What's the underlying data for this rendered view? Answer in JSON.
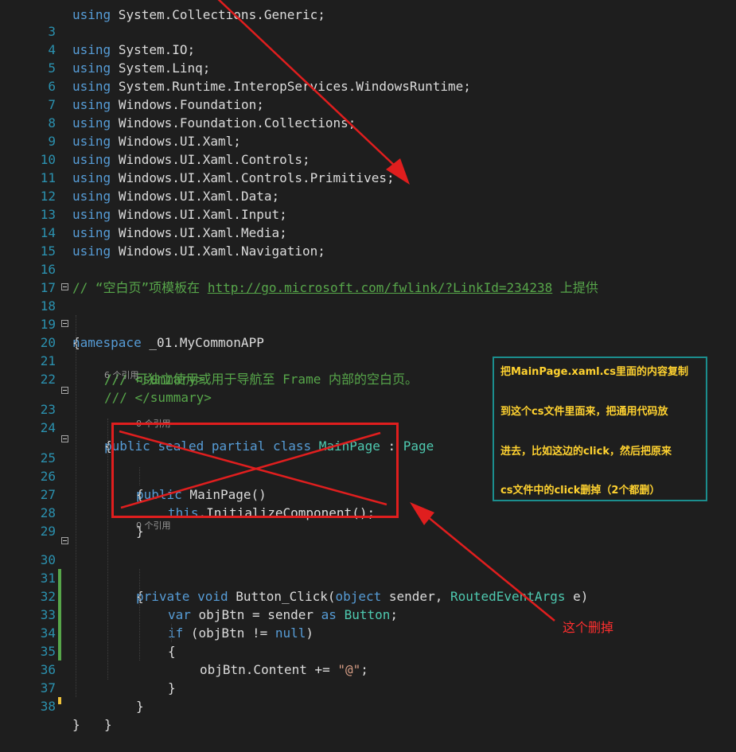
{
  "editor": {
    "line_numbers": [
      "3",
      "4",
      "5",
      "6",
      "7",
      "8",
      "9",
      "10",
      "11",
      "12",
      "13",
      "14",
      "15",
      "16",
      "17",
      "18",
      "19",
      "20",
      "21",
      "22",
      "23",
      "24",
      "25",
      "26",
      "27",
      "28",
      "29",
      "30",
      "31",
      "32",
      "33",
      "34",
      "35",
      "36",
      "37",
      "38"
    ],
    "kw_using": "using",
    "usings": [
      "System.IO;",
      "System.Linq;",
      "System.Runtime.InteropServices.WindowsRuntime;",
      "Windows.Foundation;",
      "Windows.Foundation.Collections;",
      "Windows.UI.Xaml;",
      "Windows.UI.Xaml.Controls;",
      "Windows.UI.Xaml.Controls.Primitives;",
      "Windows.UI.Xaml.Data;",
      "Windows.UI.Xaml.Input;",
      "Windows.UI.Xaml.Media;",
      "Windows.UI.Xaml.Navigation;"
    ],
    "comment_prefix": "// “空白页”项模板在 ",
    "comment_link": "http://go.microsoft.com/fwlink/?LinkId=234238",
    "comment_suffix": " 上提供",
    "kw_namespace": "namespace",
    "namespace_name": " _01.MyCommonAPP",
    "open_brace": "{",
    "close_brace": "}",
    "doc_summary_open": "/// <summary>",
    "doc_summary_text": "/// 可独立使用或用于导航至 Frame 内部的空白页。",
    "doc_summary_close": "/// </summary>",
    "codelens_class": "6 个引用",
    "codelens_ctor": "0 个引用",
    "codelens_click": "0 个引用",
    "kw_public": "public",
    "kw_sealed": "sealed",
    "kw_partial": "partial",
    "kw_class": "class",
    "class_name": "MainPage",
    "colon": " : ",
    "base_class": "Page",
    "ctor_rest": " MainPage()",
    "kw_this": "this",
    "init_call": ".InitializeComponent();",
    "kw_private": "private",
    "kw_void": "void",
    "method_name": " Button_Click(",
    "kw_object": "object",
    "param_sender": " sender, ",
    "type_routed": "RoutedEventArgs",
    "param_e": " e)",
    "kw_var": "var",
    "var_decl": " objBtn = sender ",
    "kw_as": "as",
    "type_button": "Button",
    "semicolon": ";",
    "kw_if": "if",
    "if_cond": " (objBtn != ",
    "kw_null": "null",
    "close_paren": ")",
    "content_assign": "objBtn.Content += ",
    "string_at": "\"@\"",
    "colors": {
      "background": "#1e1e1e",
      "line_number": "#2b91af",
      "keyword": "#569cd6",
      "type": "#4ec9b0",
      "comment": "#57a64a",
      "string": "#d69d85",
      "change_saved": "#57a64a",
      "change_unsaved": "#efc23b"
    }
  },
  "annotation": {
    "lines": [
      "把MainPage.xaml.cs里面的内容复制",
      "到这个cs文件里面来，把通用代码放",
      "进去，比如这边的click，然后把原来",
      "cs文件中的click删掉（2个都删）"
    ],
    "delete_label": "这个删掉",
    "annotation_color": "#e01e1e",
    "box_border": "#1b8e8e",
    "text_color": "#ffd230"
  }
}
